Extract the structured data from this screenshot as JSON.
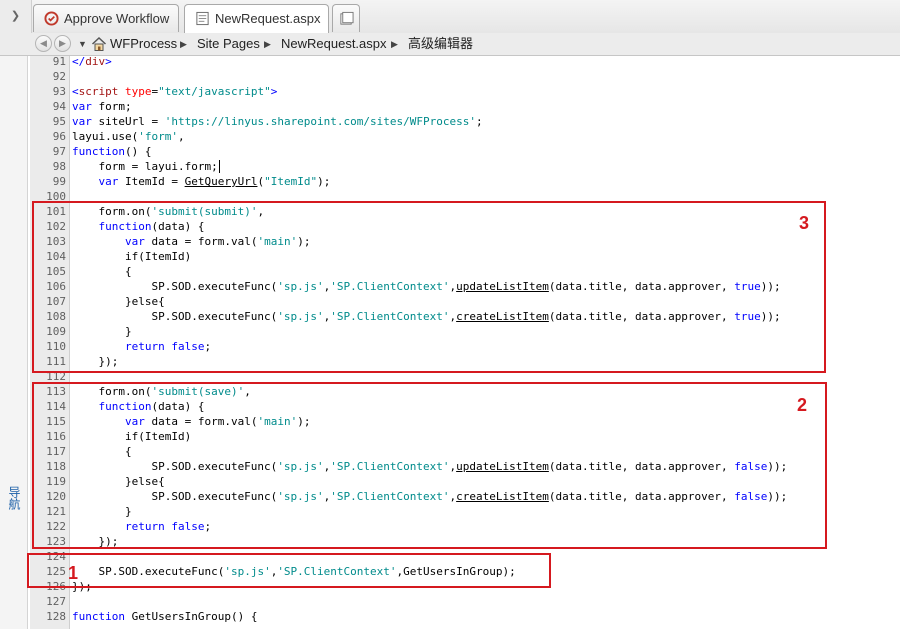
{
  "tabs": [
    {
      "label": "Approve Workflow",
      "icon": "workflow-icon"
    },
    {
      "label": "NewRequest.aspx",
      "icon": "page-icon"
    },
    {
      "label": "",
      "icon": "new-tab-icon"
    }
  ],
  "breadcrumb": [
    "WFProcess",
    "Site Pages",
    "NewRequest.aspx",
    "高级编辑器"
  ],
  "left_nav_label": "导航",
  "code_lines": [
    {
      "n": "91",
      "t": "</div>"
    },
    {
      "n": "92",
      "t": ""
    },
    {
      "n": "93",
      "t": "<script type=\"text/javascript\">"
    },
    {
      "n": "94",
      "t": "var form;"
    },
    {
      "n": "95",
      "t": "var siteUrl = 'https://linyus.sharepoint.com/sites/WFProcess';"
    },
    {
      "n": "96",
      "t": "layui.use('form',"
    },
    {
      "n": "97",
      "t": "function() {"
    },
    {
      "n": "98",
      "t": "    form = layui.form;"
    },
    {
      "n": "99",
      "t": "    var ItemId = GetQueryUrl(\"ItemId\");"
    },
    {
      "n": "100",
      "t": ""
    },
    {
      "n": "101",
      "t": "    form.on('submit(submit)',"
    },
    {
      "n": "102",
      "t": "    function(data) {"
    },
    {
      "n": "103",
      "t": "        var data = form.val('main');"
    },
    {
      "n": "104",
      "t": "        if(ItemId)"
    },
    {
      "n": "105",
      "t": "        {"
    },
    {
      "n": "106",
      "t": "            SP.SOD.executeFunc('sp.js','SP.ClientContext',updateListItem(data.title, data.approver, true));"
    },
    {
      "n": "107",
      "t": "        }else{"
    },
    {
      "n": "108",
      "t": "            SP.SOD.executeFunc('sp.js','SP.ClientContext',createListItem(data.title, data.approver, true));"
    },
    {
      "n": "109",
      "t": "        }"
    },
    {
      "n": "110",
      "t": "        return false;"
    },
    {
      "n": "111",
      "t": "    });"
    },
    {
      "n": "112",
      "t": ""
    },
    {
      "n": "113",
      "t": "    form.on('submit(save)',"
    },
    {
      "n": "114",
      "t": "    function(data) {"
    },
    {
      "n": "115",
      "t": "        var data = form.val('main');"
    },
    {
      "n": "116",
      "t": "        if(ItemId)"
    },
    {
      "n": "117",
      "t": "        {"
    },
    {
      "n": "118",
      "t": "            SP.SOD.executeFunc('sp.js','SP.ClientContext',updateListItem(data.title, data.approver, false));"
    },
    {
      "n": "119",
      "t": "        }else{"
    },
    {
      "n": "120",
      "t": "            SP.SOD.executeFunc('sp.js','SP.ClientContext',createListItem(data.title, data.approver, false));"
    },
    {
      "n": "121",
      "t": "        }"
    },
    {
      "n": "122",
      "t": "        return false;"
    },
    {
      "n": "123",
      "t": "    });"
    },
    {
      "n": "124",
      "t": ""
    },
    {
      "n": "125",
      "t": "    SP.SOD.executeFunc('sp.js','SP.ClientContext',GetUsersInGroup);"
    },
    {
      "n": "126",
      "t": "});"
    },
    {
      "n": "127",
      "t": ""
    },
    {
      "n": "128",
      "t": "function GetUsersInGroup() {"
    }
  ],
  "annotations": [
    "3",
    "2",
    "1"
  ],
  "colors": {
    "annotation": "#d5191f",
    "keyword": "#0000ff",
    "string": "#008b8b",
    "tag": "#a31515"
  }
}
